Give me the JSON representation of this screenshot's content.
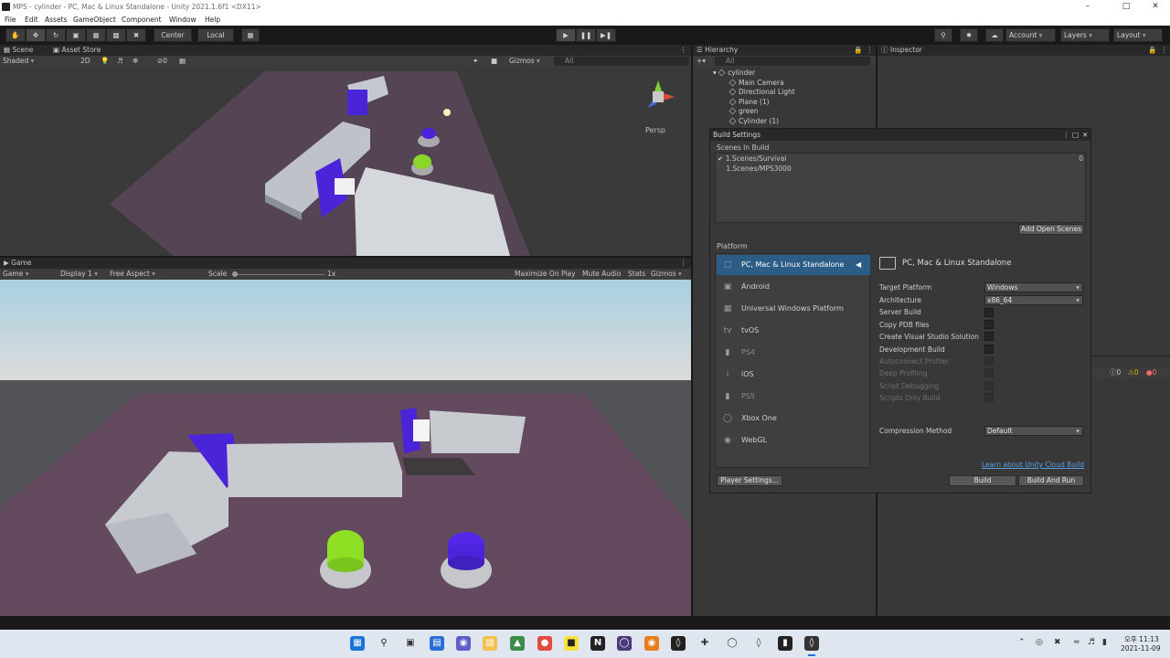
{
  "window": {
    "title": "MPS - cylinder - PC, Mac & Linux Standalone - Unity 2021.1.6f1 <DX11>"
  },
  "menu": [
    "File",
    "Edit",
    "Assets",
    "GameObject",
    "Component",
    "Window",
    "Help"
  ],
  "toolbar": {
    "pivot": "Center",
    "space": "Local",
    "account": "Account",
    "layers": "Layers",
    "layout": "Layout"
  },
  "scene": {
    "tab_scene": "Scene",
    "tab_store": "Asset Store",
    "shading": "Shaded",
    "mode2d": "2D",
    "fx_count": "0",
    "gizmos": "Gizmos",
    "search": "All",
    "persp": "Persp"
  },
  "game": {
    "tab": "Game",
    "view": "Game",
    "display": "Display 1",
    "aspect": "Free Aspect",
    "scale_label": "Scale",
    "scale_value": "1x",
    "maximize": "Maximize On Play",
    "mute": "Mute Audio",
    "stats": "Stats",
    "gizmos": "Gizmos"
  },
  "hierarchy": {
    "tab": "Hierarchy",
    "search": "All",
    "root": "cylinder",
    "items": [
      "Main Camera",
      "Directional Light",
      "Plane (1)",
      "green",
      "Cylinder (1)"
    ]
  },
  "inspector": {
    "tab": "Inspector"
  },
  "console": {
    "errors": "0",
    "warnings": "0",
    "messages": "0"
  },
  "build": {
    "title": "Build Settings",
    "scenes_header": "Scenes In Build",
    "scenes": [
      {
        "name": "1.Scenes/Survival",
        "index": "0"
      },
      {
        "name": "1.Scenes/MPS3000",
        "index": ""
      }
    ],
    "add_open": "Add Open Scenes",
    "platform_header": "Platform",
    "platforms": [
      {
        "label": "PC, Mac & Linux Standalone",
        "icon": "monitor-icon"
      },
      {
        "label": "Android",
        "icon": "android-icon"
      },
      {
        "label": "Universal Windows Platform",
        "icon": "windows-icon"
      },
      {
        "label": "tvOS",
        "icon": "tvos-icon"
      },
      {
        "label": "PS4",
        "icon": "ps4-icon"
      },
      {
        "label": "iOS",
        "icon": "ios-icon"
      },
      {
        "label": "PS5",
        "icon": "ps5-icon"
      },
      {
        "label": "Xbox One",
        "icon": "xbox-icon"
      },
      {
        "label": "WebGL",
        "icon": "html5-icon"
      }
    ],
    "selected_title": "PC, Mac & Linux Standalone",
    "target_platform_label": "Target Platform",
    "target_platform": "Windows",
    "architecture_label": "Architecture",
    "architecture": "x86_64",
    "toggles": [
      "Server Build",
      "Copy PDB files",
      "Create Visual Studio Solution",
      "Development Build"
    ],
    "disabled": [
      "Autoconnect Profiler",
      "Deep Profiling",
      "Script Debugging",
      "Scripts Only Build"
    ],
    "compression_label": "Compression Method",
    "compression": "Default",
    "cloud_link": "Learn about Unity Cloud Build",
    "player_settings": "Player Settings...",
    "build": "Build",
    "build_run": "Build And Run"
  },
  "taskbar": {
    "time": "오후 11:13",
    "date": "2021-11-09"
  }
}
